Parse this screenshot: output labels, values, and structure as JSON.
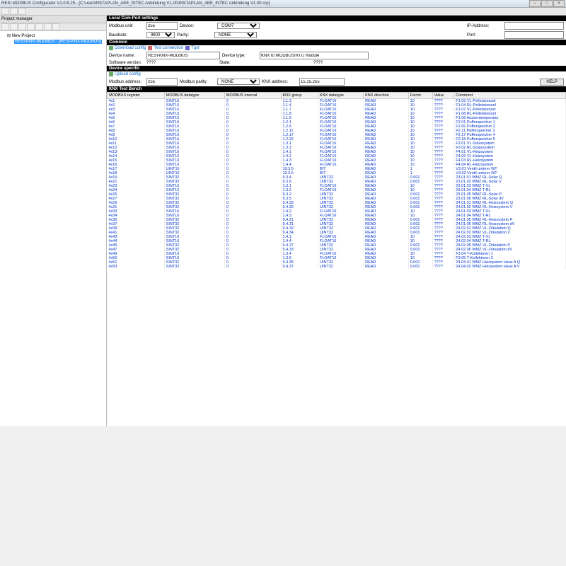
{
  "title": "RESI MODBUS Configurator V1.0.5.25 - [C:\\user\\INSTAPLAN_AEE_INTEC Anbindung V1.00\\INSTAPLAN_AEE_INTEC Anbindung V1.00.rcp]",
  "toolbar": {
    "project_manager": "Project manager"
  },
  "tree": {
    "root": "New Project",
    "sel": "RESI-KNX-MODBUS - [RESI-KNX-MODBUS]"
  },
  "sections": {
    "local": "Local Com-Port settings",
    "common": "Common",
    "devspec": "Device specific",
    "testbench": "KNX Test Bench"
  },
  "local": {
    "modbus_unit_l": "Modbus unit:",
    "modbus_unit": "255",
    "device_l": "Device:",
    "device": "COM7",
    "ip_l": "IP-Address:",
    "ip": "",
    "baud_l": "Baudrate:",
    "baud": "9600",
    "parity_l": "Parity:",
    "parity": "NONE",
    "port_l": "Port:",
    "port": ""
  },
  "common": {
    "download": "Download config",
    "test": "Test connection",
    "tgst": "Tgst",
    "devname_l": "Device name:",
    "devname": "RESI-KNX-MODBUS",
    "devtype_l": "Device type:",
    "devtype": "KNX to MODBUS/RTU module",
    "swver_l": "Software version:",
    "swver": "????",
    "state_l": "State:",
    "state": "????"
  },
  "devspec": {
    "upload": "Upload config",
    "mbaddr_l": "Modbus address:",
    "mbaddr": "255",
    "mbparity_l": "Modbus parity:",
    "mbparity": "NONE",
    "knxaddr_l": "KNX address:",
    "knxaddr": "15.15.255",
    "help": "HELP"
  },
  "cols": [
    "MODBUS register",
    "MODBUS datatype",
    "MODBUS interval",
    "KNX group",
    "KNX datatype",
    "KNX direction",
    "Factor",
    "Value",
    "Comment"
  ],
  "rows": [
    [
      "4x1",
      "SINT16",
      "0",
      "1.1.3",
      "FLOAT16",
      "READ",
      "10",
      "????",
      "F1.03 VL-Pelletskessel"
    ],
    [
      "4x2",
      "SINT16",
      "0",
      "1.1.4",
      "FLOAT16",
      "READ",
      "10",
      "????",
      "F1.04 RL-Pelletskessel"
    ],
    [
      "4x3",
      "SINT16",
      "0",
      "1.1.7",
      "FLOAT16",
      "READ",
      "10",
      "????",
      "F1.07 VL-Pelletskessel"
    ],
    [
      "4x4",
      "SINT16",
      "0",
      "1.1.8",
      "FLOAT16",
      "READ",
      "10",
      "????",
      "F1.08 RL-Pelletskessel"
    ],
    [
      "4x5",
      "SINT16",
      "0",
      "1.1.9",
      "FLOAT16",
      "READ",
      "10",
      "????",
      "F1.09 Aussentemperatur"
    ],
    [
      "4x6",
      "SINT16",
      "0",
      "1.2.1",
      "FLOAT16",
      "READ",
      "10",
      "????",
      "F2.01 Pufferspeicher 1"
    ],
    [
      "4x7",
      "SINT16",
      "0",
      "1.2.6",
      "FLOAT16",
      "READ",
      "10",
      "????",
      "F2.06 Pufferspeicher 2"
    ],
    [
      "4x8",
      "SINT16",
      "0",
      "1.2.11",
      "FLOAT16",
      "READ",
      "10",
      "????",
      "F2.11 Pufferspeicher 3"
    ],
    [
      "4x9",
      "SINT16",
      "0",
      "1.2.17",
      "FLOAT16",
      "READ",
      "10",
      "????",
      "F2.17 Pufferspeicher 4"
    ],
    [
      "4x10",
      "SINT16",
      "0",
      "1.2.22",
      "FLOAT16",
      "READ",
      "10",
      "????",
      "F2.18 Pufferspeicher 5"
    ],
    [
      "4x11",
      "SINT16",
      "0",
      "1.3.1",
      "FLOAT16",
      "READ",
      "10",
      "????",
      "F3.01 VL-Solarsystem"
    ],
    [
      "4x12",
      "SINT16",
      "0",
      "1.3.2",
      "FLOAT16",
      "READ",
      "10",
      "????",
      "F3.02 RL-Solarsystem"
    ],
    [
      "4x13",
      "SINT16",
      "0",
      "1.4.1",
      "FLOAT16",
      "READ",
      "10",
      "????",
      "F4.01 VL-Heizsystem"
    ],
    [
      "4x14",
      "SINT16",
      "0",
      "1.4.2",
      "FLOAT16",
      "READ",
      "10",
      "????",
      "F4.02 VL-Heizsystem"
    ],
    [
      "4x15",
      "SINT16",
      "0",
      "1.4.3",
      "FLOAT16",
      "READ",
      "10",
      "????",
      "F4.03 RL-Heizsystem"
    ],
    [
      "4x16",
      "SINT16",
      "0",
      "1.4.4",
      "FLOAT16",
      "READ",
      "10",
      "????",
      "F4.04 RL-Heizsystem"
    ],
    [
      "4x17",
      "UINT16",
      "0",
      "10.3.5",
      "BIT",
      "READ",
      "1",
      "????",
      "V3.01 Ventil unterer WT"
    ],
    [
      "4x18",
      "UINT16",
      "0",
      "10.3.6",
      "BIT",
      "READ",
      "1",
      "????",
      "V3.02 Ventil unterer WT"
    ],
    [
      "4x19",
      "SINT32",
      "0",
      "9.3.4",
      "UINT32",
      "READ",
      "0.001",
      "????",
      "23.01.01 WMZ RL-Solar Q"
    ],
    [
      "4x21",
      "SINT32",
      "0",
      "9.3.6",
      "UINT32",
      "READ",
      "0.001",
      "????",
      "23.01.02 WMZ RL-Solar V"
    ],
    [
      "4x23",
      "SINT16",
      "0",
      "1.3.1",
      "FLOAT16",
      "READ",
      "10",
      "????",
      "23.01.03 WMZ T-VL"
    ],
    [
      "4x24",
      "SINT16",
      "0",
      "1.3.2",
      "FLOAT16",
      "READ",
      "10",
      "????",
      "23.01.04 WMZ T-RL"
    ],
    [
      "4x25",
      "SINT32",
      "0",
      "9.3.2",
      "UINT32",
      "READ",
      "0.001",
      "????",
      "23.01.05 WMZ RL-Solar P"
    ],
    [
      "4x27",
      "SINT32",
      "0",
      "9.3.5",
      "UINT32",
      "READ",
      "0.001",
      "????",
      "23.01.06 WMZ RL-Solar dV"
    ],
    [
      "4x29",
      "SINT32",
      "0",
      "9.4.29",
      "UINT32",
      "READ",
      "0.001",
      "????",
      "24.01.01 WMZ RL-Heizsystem Q"
    ],
    [
      "4x31",
      "SINT32",
      "0",
      "9.4.30",
      "UINT32",
      "READ",
      "0.001",
      "????",
      "24.01.02 WMZ RL-Heizsystem V"
    ],
    [
      "4x33",
      "SINT16",
      "0",
      "1.4.2",
      "FLOAT16",
      "READ",
      "10",
      "????",
      "24.01.03 WMZ T-VL"
    ],
    [
      "4x34",
      "SINT16",
      "0",
      "1.4.3",
      "FLOAT16",
      "READ",
      "10",
      "????",
      "24.01.04 WMZ T-RL"
    ],
    [
      "4x35",
      "SINT32",
      "0",
      "9.4.21",
      "UINT32",
      "READ",
      "0.001",
      "????",
      "24.01.05 WMZ RL-Heizsystem P"
    ],
    [
      "4x37",
      "SINT32",
      "0",
      "9.4.31",
      "UINT32",
      "READ",
      "0.001",
      "????",
      "24.01.06 WMZ RL-Heizsystem dV"
    ],
    [
      "4x39",
      "SINT32",
      "0",
      "9.4.32",
      "UINT32",
      "READ",
      "0.001",
      "????",
      "24.02.01 WMZ VL-Zirkulation Q"
    ],
    [
      "4x41",
      "SINT32",
      "0",
      "9.4.34",
      "UINT32",
      "READ",
      "0.001",
      "????",
      "24.02.02 WMZ VL-Zirkulation V"
    ],
    [
      "4x43",
      "SINT16",
      "0",
      "1.4.1",
      "FLOAT16",
      "READ",
      "10",
      "????",
      "24.02.03 WMZ T-VL"
    ],
    [
      "4x44",
      "SINT16",
      "0",
      "1.4.4",
      "FLOAT16",
      "READ",
      "10",
      "????",
      "24.02.04 WMZ T-RL"
    ],
    [
      "4x45",
      "SINT32",
      "0",
      "9.4.27",
      "UINT32",
      "READ",
      "0.001",
      "????",
      "24.02.05 WMZ VL-Zirkulation P"
    ],
    [
      "4x47",
      "SINT32",
      "0",
      "9.4.33",
      "UINT32",
      "READ",
      "0.001",
      "????",
      "24.02.06 WMZ VL-Zirkulation dV"
    ],
    [
      "4x49",
      "SINT16",
      "0",
      "1.3.4",
      "FLOAT16",
      "READ",
      "10",
      "????",
      "F3.04 T-Kollektoren 1"
    ],
    [
      "4x50",
      "SINT16",
      "0",
      "1.3.5",
      "FLOAT16",
      "READ",
      "10",
      "????",
      "F3.05 T-Kollektoren 2"
    ],
    [
      "4x51",
      "SINT32",
      "0",
      "9.4.35",
      "UINT32",
      "READ",
      "0.001",
      "????",
      "24.04.01 WMZ Heizsystem Haus A Q"
    ],
    [
      "4x53",
      "SINT32",
      "0",
      "9.4.37",
      "UINT32",
      "READ",
      "0.001",
      "????",
      "24.04.02 WMZ Heizsystem Haus A V"
    ]
  ]
}
